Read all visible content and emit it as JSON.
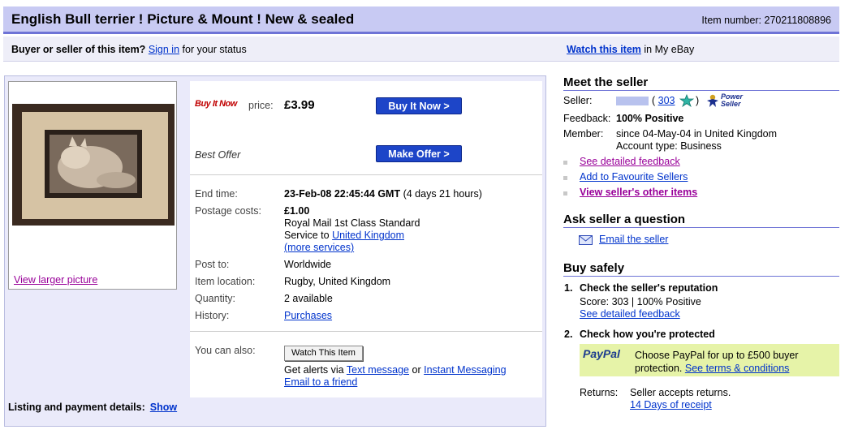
{
  "header": {
    "title": "English Bull terrier ! Picture & Mount ! New & sealed",
    "item_number": "Item number: 270211808896"
  },
  "buyer_bar": {
    "question": "Buyer or seller of this item?",
    "sign_in": "Sign in",
    "status_text": "for your status",
    "watch_link": "Watch this item",
    "watch_suffix": "in My eBay"
  },
  "photo": {
    "view_larger": "View larger picture"
  },
  "purchase": {
    "buy_it_now_logo": "Buy It Now",
    "price_label": "price:",
    "price": "£3.99",
    "buy_button": "Buy It Now >",
    "best_offer_label": "Best Offer",
    "offer_button": "Make Offer >"
  },
  "details": {
    "end_time_label": "End time:",
    "end_time": "23-Feb-08 22:45:44 GMT",
    "time_left": "(4 days 21 hours)",
    "postage_label": "Postage costs:",
    "postage_cost": "£1.00",
    "postage_service": "Royal Mail 1st Class Standard",
    "service_to": "Service to",
    "service_country": "United Kingdom",
    "more_services": "(more services)",
    "post_to_label": "Post to:",
    "post_to": "Worldwide",
    "location_label": "Item location:",
    "location": "Rugby, United Kingdom",
    "quantity_label": "Quantity:",
    "quantity": "2 available",
    "history_label": "History:",
    "history": "Purchases",
    "can_also_label": "You can also:",
    "watch_button": "Watch This Item",
    "alerts_text": "Get alerts via",
    "text_message": "Text message",
    "or_text": "or",
    "instant_messaging": "Instant Messaging",
    "email_friend": "Email to a friend"
  },
  "listing": {
    "label": "Listing and payment details:",
    "show": "Show"
  },
  "seller": {
    "heading": "Meet the seller",
    "seller_label": "Seller:",
    "feedback_count": "303",
    "power_seller": "Power Seller",
    "feedback_label": "Feedback:",
    "feedback_value": "100% Positive",
    "member_label": "Member:",
    "member_since": "since 04-May-04 in United Kingdom",
    "account_type": "Account type: Business",
    "link_feedback": "See detailed feedback",
    "link_favourite": "Add to Favourite Sellers",
    "link_other_items": "View seller's other items"
  },
  "ask": {
    "heading": "Ask seller a question",
    "email_link": "Email the seller"
  },
  "safety": {
    "heading": "Buy safely",
    "step1_num": "1.",
    "step1_title": "Check the seller's reputation",
    "score_text": "Score: 303 | 100% Positive",
    "step1_link": "See detailed feedback",
    "step2_num": "2.",
    "step2_title": "Check how you're protected",
    "paypal_logo": "PayPal",
    "paypal_text": "Choose PayPal for up to £500 buyer protection.",
    "paypal_link": "See terms & conditions",
    "returns_label": "Returns:",
    "returns_text": "Seller accepts returns.",
    "returns_link": "14 Days of receipt"
  },
  "colors": {
    "title_bg": "#c8caf3",
    "title_border": "#6e73d6",
    "button_blue": "#1d45c8",
    "link_blue": "#0033cc",
    "link_purple": "#990099",
    "paypal_bg": "#e6f3a8"
  }
}
